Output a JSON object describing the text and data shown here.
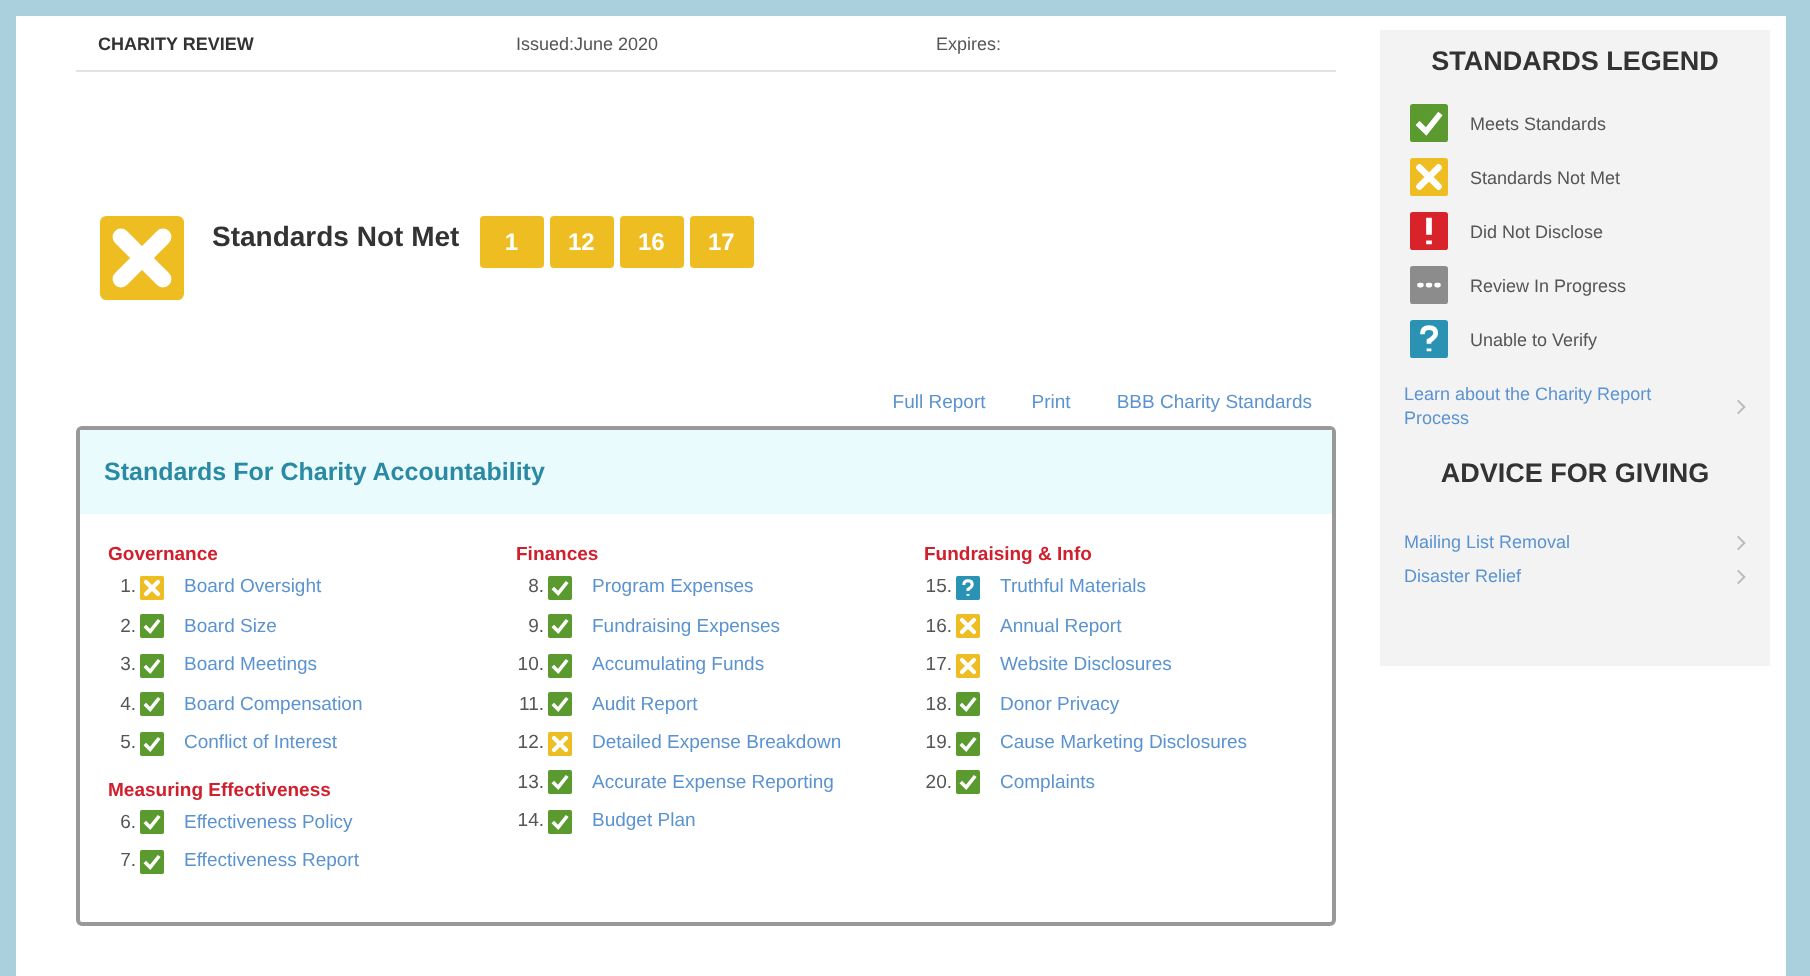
{
  "header": {
    "title": "CHARITY REVIEW",
    "issued": "Issued:June 2020",
    "expires": "Expires:"
  },
  "summary": {
    "kind": "not_met",
    "label": "Standards Not Met",
    "standards": [
      "1",
      "12",
      "16",
      "17"
    ]
  },
  "links": [
    "Full Report",
    "Print",
    "BBB Charity Standards"
  ],
  "standards_panel": {
    "title": "Standards For Charity Accountability",
    "columns": [
      {
        "groups": [
          {
            "heading": "Governance",
            "items": [
              {
                "number": "1.",
                "kind": "not_met",
                "label": "Board Oversight"
              },
              {
                "number": "2.",
                "kind": "meets",
                "label": "Board Size"
              },
              {
                "number": "3.",
                "kind": "meets",
                "label": "Board Meetings"
              },
              {
                "number": "4.",
                "kind": "meets",
                "label": "Board Compensation"
              },
              {
                "number": "5.",
                "kind": "meets",
                "label": "Conflict of Interest"
              }
            ]
          },
          {
            "heading": "Measuring Effectiveness",
            "items": [
              {
                "number": "6.",
                "kind": "meets",
                "label": "Effectiveness Policy"
              },
              {
                "number": "7.",
                "kind": "meets",
                "label": "Effectiveness Report"
              }
            ]
          }
        ]
      },
      {
        "groups": [
          {
            "heading": "Finances",
            "items": [
              {
                "number": "8.",
                "kind": "meets",
                "label": "Program Expenses"
              },
              {
                "number": "9.",
                "kind": "meets",
                "label": "Fundraising Expenses"
              },
              {
                "number": "10.",
                "kind": "meets",
                "label": "Accumulating Funds"
              },
              {
                "number": "11.",
                "kind": "meets",
                "label": "Audit Report"
              },
              {
                "number": "12.",
                "kind": "not_met",
                "label": "Detailed Expense Breakdown"
              },
              {
                "number": "13.",
                "kind": "meets",
                "label": "Accurate Expense Reporting"
              },
              {
                "number": "14.",
                "kind": "meets",
                "label": "Budget Plan"
              }
            ]
          }
        ]
      },
      {
        "groups": [
          {
            "heading": "Fundraising & Info",
            "items": [
              {
                "number": "15.",
                "kind": "unverified",
                "label": "Truthful Materials"
              },
              {
                "number": "16.",
                "kind": "not_met",
                "label": "Annual Report"
              },
              {
                "number": "17.",
                "kind": "not_met",
                "label": "Website Disclosures"
              },
              {
                "number": "18.",
                "kind": "meets",
                "label": "Donor Privacy"
              },
              {
                "number": "19.",
                "kind": "meets",
                "label": "Cause Marketing Disclosures"
              },
              {
                "number": "20.",
                "kind": "meets",
                "label": "Complaints"
              }
            ]
          }
        ]
      }
    ]
  },
  "sidebar": {
    "legend_title": "STANDARDS LEGEND",
    "legend": [
      {
        "kind": "meets",
        "label": "Meets Standards"
      },
      {
        "kind": "not_met",
        "label": "Standards Not Met"
      },
      {
        "kind": "not_disclosed",
        "label": "Did Not Disclose"
      },
      {
        "kind": "in_progress",
        "label": "Review In Progress"
      },
      {
        "kind": "unverified",
        "label": "Unable to Verify"
      }
    ],
    "learn_link": "Learn about the Charity Report Process",
    "advice_title": "ADVICE FOR GIVING",
    "advice_links": [
      "Mailing List Removal",
      "Disaster Relief"
    ]
  }
}
